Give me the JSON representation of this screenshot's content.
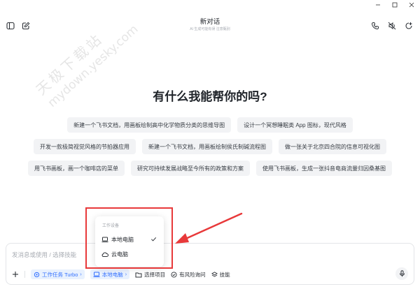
{
  "header": {
    "title": "新对话",
    "subtitle": "AI 生成可能有误 注意甄别"
  },
  "watermark": {
    "text_cn": "天极下载站",
    "text_url": "mydown.yesky.com"
  },
  "main": {
    "heading": "有什么我能帮你的吗?",
    "suggestions": [
      [
        "新建一个飞书文档，用画板绘制高中化学物质分类的思维导图",
        "设计一个冥想睡眠类 App 图标，现代风格"
      ],
      [
        "开发一款极简视觉风格的节拍器应用",
        "新建一个飞书文档，用画板绘制侯氏制碱流程图",
        "做一张关于北京四合院的信息可视化图"
      ],
      [
        "用飞书画板，画一个咖啡店的菜单",
        "研究可持续发展战略至今所有的政策和方案",
        "使用飞书画板，生成一张抖音电商流量归因桑基图"
      ]
    ]
  },
  "dropdown": {
    "header": "工作设备",
    "items": [
      {
        "label": "本地电脑",
        "selected": true
      },
      {
        "label": "云电脑",
        "selected": false
      }
    ]
  },
  "input": {
    "placeholder": "发消息或使用 / 选择技能",
    "toolbar": {
      "work_task": "工作任务 Turbo",
      "device": "本地电脑",
      "select_project": "选择项目",
      "risk_query": "有风险询问",
      "skills": "技能"
    }
  },
  "colors": {
    "accent": "#3370ff",
    "annotation": "#e8393a"
  }
}
